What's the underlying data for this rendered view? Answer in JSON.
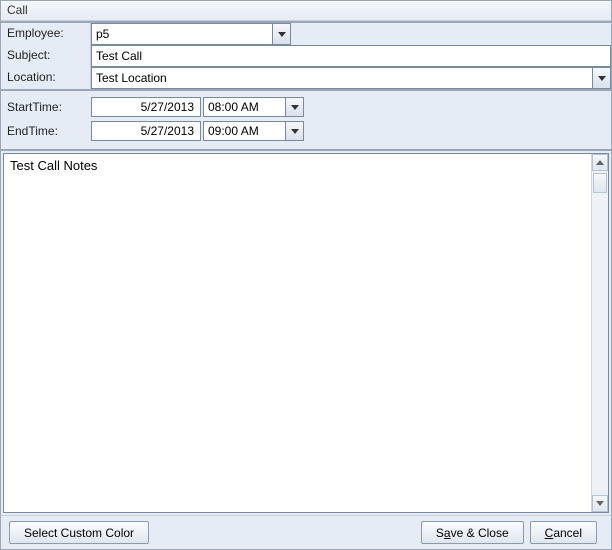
{
  "titlebar": {
    "title": "Call"
  },
  "form": {
    "employee_label": "Employee:",
    "employee_value": "p5",
    "subject_label": "Subject:",
    "subject_value": "Test Call",
    "location_label": "Location:",
    "location_value": "Test Location"
  },
  "time": {
    "start_label": "StartTime:",
    "start_date": "5/27/2013",
    "start_time": "08:00 AM",
    "end_label": "EndTime:",
    "end_date": "5/27/2013",
    "end_time": "09:00 AM"
  },
  "notes": {
    "value": "Test Call Notes"
  },
  "buttons": {
    "select_color": "Select Custom Color",
    "save_close_pre": "S",
    "save_close_u": "a",
    "save_close_post": "ve & Close",
    "cancel_pre": "",
    "cancel_u": "C",
    "cancel_post": "ancel"
  }
}
